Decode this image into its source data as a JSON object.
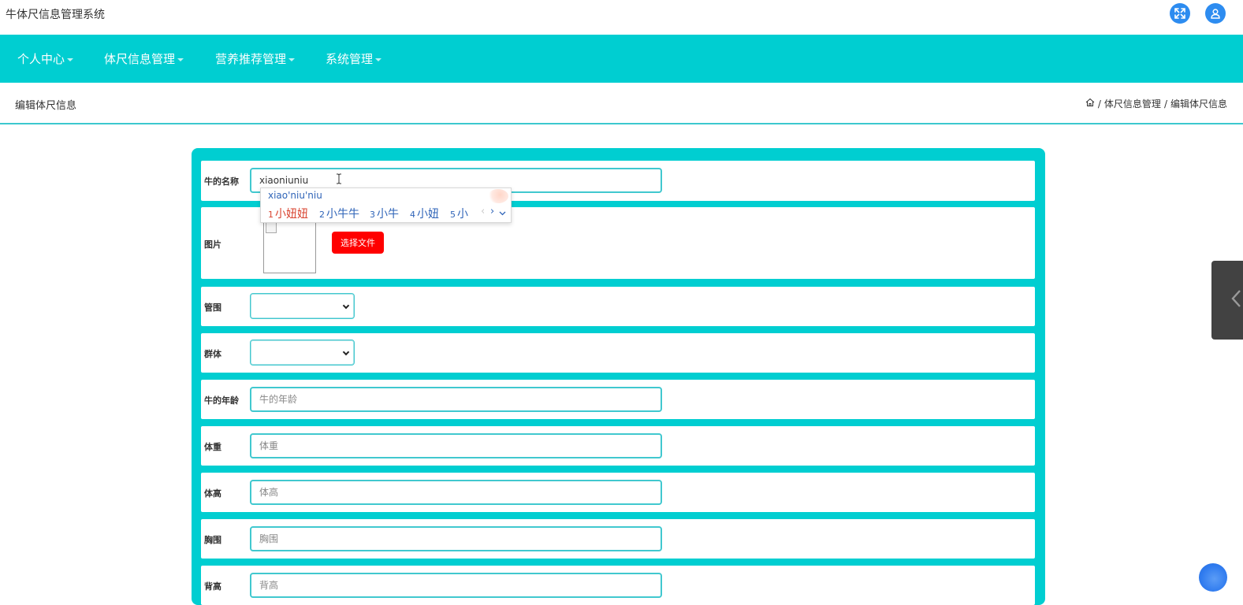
{
  "app": {
    "title": "牛体尺信息管理系统"
  },
  "topbar": {
    "fullscreen_icon": "fullscreen-expand-icon",
    "user_icon": "user-avatar-icon",
    "icon_color": "#2d8cf0"
  },
  "nav": {
    "background": "#00ced1",
    "items": [
      {
        "label": "个人中心"
      },
      {
        "label": "体尺信息管理"
      },
      {
        "label": "营养推荐管理"
      },
      {
        "label": "系统管理"
      }
    ]
  },
  "subheader": {
    "title": "编辑体尺信息",
    "breadcrumb": [
      {
        "label": "体尺信息管理"
      },
      {
        "label": "编辑体尺信息"
      }
    ],
    "separator": "/",
    "home_icon": "home-icon"
  },
  "form": {
    "card_color": "#00ced1",
    "fields": {
      "name": {
        "label": "牛的名称",
        "value": "xiaoniuniu"
      },
      "image": {
        "label": "图片",
        "button_label": "选择文件"
      },
      "guanwei": {
        "label": "管围",
        "value": ""
      },
      "qunti": {
        "label": "群体",
        "value": ""
      },
      "age": {
        "label": "牛的年龄",
        "placeholder": "牛的年龄"
      },
      "weight": {
        "label": "体重",
        "placeholder": "体重"
      },
      "height": {
        "label": "体高",
        "placeholder": "体高"
      },
      "chest": {
        "label": "胸围",
        "placeholder": "胸围"
      },
      "back_height": {
        "label": "背高",
        "placeholder": "背高"
      }
    }
  },
  "ime": {
    "pinyin": "xiao'niu'niu",
    "candidates": [
      {
        "num": "1",
        "text": "小妞妞",
        "selected": true
      },
      {
        "num": "2",
        "text": "小牛牛",
        "selected": false
      },
      {
        "num": "3",
        "text": "小牛",
        "selected": false
      },
      {
        "num": "4",
        "text": "小妞",
        "selected": false
      },
      {
        "num": "5",
        "text": "小",
        "selected": false
      }
    ],
    "prev_icon": "chevron-left-icon",
    "next_icon": "chevron-right-icon",
    "expand_icon": "chevron-down-icon"
  },
  "side_panel": {
    "toggle_icon": "chevron-left-icon"
  }
}
